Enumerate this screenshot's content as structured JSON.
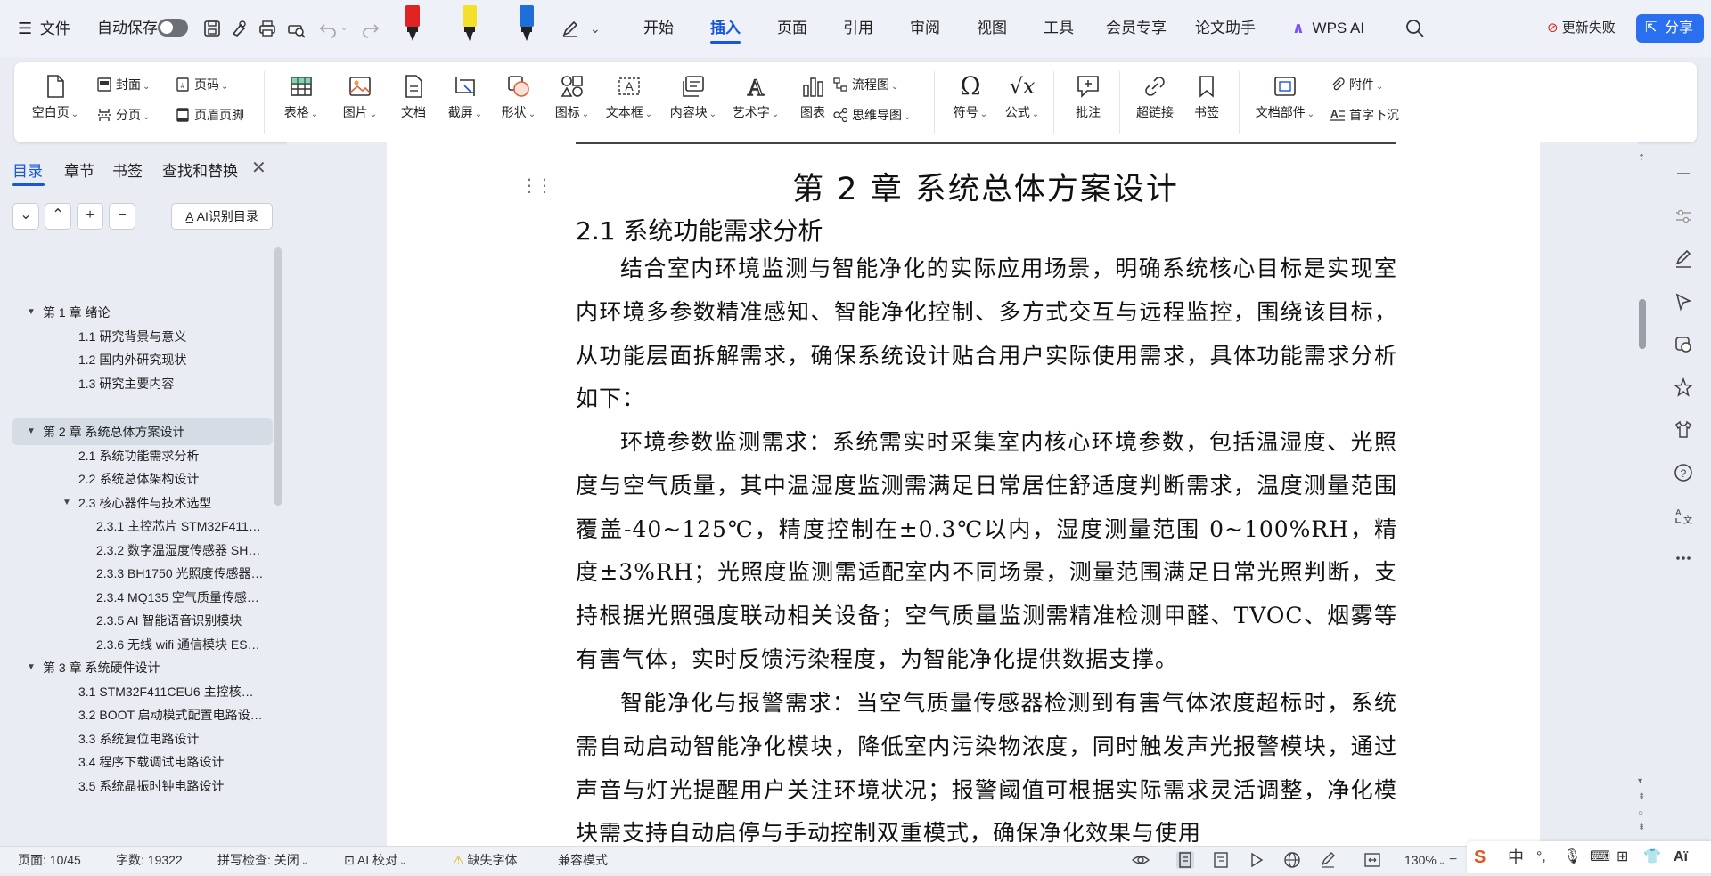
{
  "menu": {
    "file": "文件",
    "autosave": "自动保存",
    "tabs": [
      "开始",
      "插入",
      "页面",
      "引用",
      "审阅",
      "视图",
      "工具",
      "会员专享",
      "论文助手"
    ],
    "active_tab": "插入",
    "wps_ai": "WPS AI",
    "sync_fail": "更新失败",
    "share": "分享",
    "accent": "#1a56db"
  },
  "ribbon": {
    "blank_page": "空白页",
    "cover": "封面",
    "page_number": "页码",
    "section_break": "分页",
    "header_footer": "页眉页脚",
    "table": "表格",
    "picture": "图片",
    "document": "文档",
    "screenshot": "截屏",
    "shape": "形状",
    "icon": "图标",
    "textbox": "文本框",
    "content_block": "内容块",
    "wordart": "艺术字",
    "chart": "图表",
    "flowchart": "流程图",
    "mindmap": "思维导图",
    "symbol": "符号",
    "formula": "公式",
    "comment": "批注",
    "hyperlink": "超链接",
    "bookmark": "书签",
    "doc_parts": "文档部件",
    "attachment": "附件",
    "drop_cap": "首字下沉"
  },
  "nav": {
    "tabs": [
      "目录",
      "章节",
      "书签",
      "查找和替换"
    ],
    "ai_toc": "AI识别目录",
    "items": [
      {
        "label": "第 1 章 绪论",
        "level": 1,
        "expanded": true
      },
      {
        "label": "1.1 研究背景与意义",
        "level": 2
      },
      {
        "label": "1.2 国内外研究现状",
        "level": 2
      },
      {
        "label": "1.3 研究主要内容",
        "level": 2
      },
      {
        "label": "第 2 章 系统总体方案设计",
        "level": 1,
        "expanded": true,
        "selected": true
      },
      {
        "label": "2.1 系统功能需求分析",
        "level": 2
      },
      {
        "label": "2.2 系统总体架构设计",
        "level": 2
      },
      {
        "label": "2.3 核心器件与技术选型",
        "level": 2,
        "expanded": true
      },
      {
        "label": "2.3.1 主控芯片 STM32F411…",
        "level": 3
      },
      {
        "label": "2.3.2 数字温湿度传感器 SHT…",
        "level": 3
      },
      {
        "label": "2.3.3 BH1750 光照度传感器…",
        "level": 3
      },
      {
        "label": "2.3.4 MQ135 空气质量传感…",
        "level": 3
      },
      {
        "label": "2.3.5 AI 智能语音识别模块",
        "level": 3
      },
      {
        "label": "2.3.6 无线 wifi 通信模块 ESP…",
        "level": 3
      },
      {
        "label": "第 3 章 系统硬件设计",
        "level": 1,
        "expanded": true
      },
      {
        "label": "3.1 STM32F411CEU6 主控核…",
        "level": 2
      },
      {
        "label": "3.2 BOOT 启动模式配置电路设…",
        "level": 2
      },
      {
        "label": "3.3 系统复位电路设计",
        "level": 2
      },
      {
        "label": "3.4 程序下载调试电路设计",
        "level": 2
      },
      {
        "label": "3.5 系统晶振时钟电路设计",
        "level": 2
      }
    ]
  },
  "doc": {
    "chapter_title": "第 2 章 系统总体方案设计",
    "section_title": "2.1  系统功能需求分析",
    "paragraphs": [
      "结合室内环境监测与智能净化的实际应用场景，明确系统核心目标是实现室内环境多参数精准感知、智能净化控制、多方式交互与远程监控，围绕该目标，从功能层面拆解需求，确保系统设计贴合用户实际使用需求，具体功能需求分析如下：",
      "环境参数监测需求：系统需实时采集室内核心环境参数，包括温湿度、光照度与空气质量，其中温湿度监测需满足日常居住舒适度判断需求，温度测量范围覆盖-40~125℃，精度控制在±0.3℃以内，湿度测量范围 0~100%RH，精度±3%RH；光照度监测需适配室内不同场景，测量范围满足日常光照判断，支持根据光照强度联动相关设备；空气质量监测需精准检测甲醛、TVOC、烟雾等有害气体，实时反馈污染程度，为智能净化提供数据支撑。",
      "智能净化与报警需求：当空气质量传感器检测到有害气体浓度超标时，系统需自动启动智能净化模块，降低室内污染物浓度，同时触发声光报警模块，通过声音与灯光提醒用户关注环境状况；报警阈值可根据实际需求灵活调整，净化模块需支持自动启停与手动控制双重模式，确保净化效果与使用"
    ]
  },
  "status": {
    "page": "页面: 10/45",
    "words": "字数: 19322",
    "spell": "拼写检查: 关闭",
    "ai_check": "AI 校对",
    "missing_font": "缺失字体",
    "compat": "兼容模式",
    "zoom": "130%",
    "ime_lang": "中"
  }
}
